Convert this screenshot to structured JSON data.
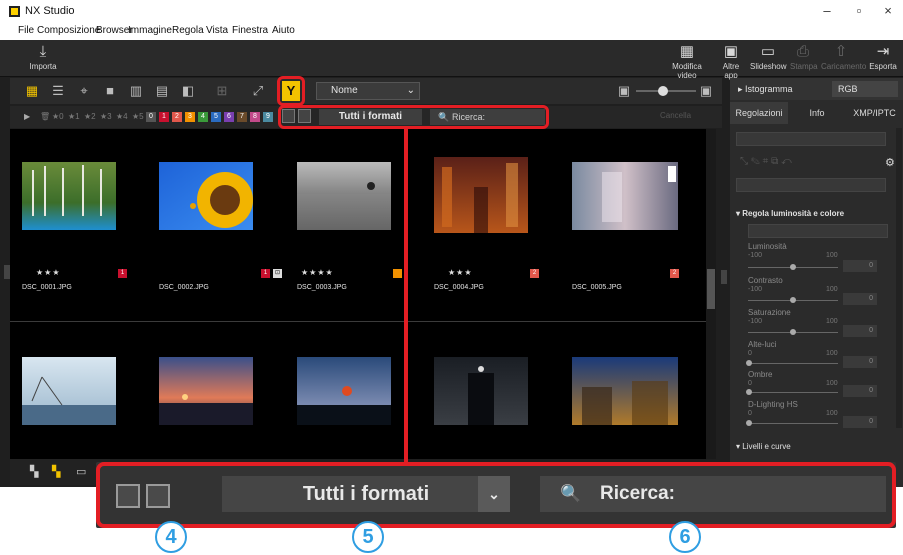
{
  "window": {
    "title": "NX Studio",
    "controls": [
      "–",
      "▫",
      "×"
    ]
  },
  "menu": [
    "File",
    "Composizione",
    "Browser",
    "Immagine",
    "Regola",
    "Vista",
    "Finestra",
    "Aiuto"
  ],
  "toolbar": {
    "import_label": "Importa",
    "right_buttons": [
      {
        "label": "Modifica video",
        "icon": "video-edit-icon",
        "disabled": false
      },
      {
        "label": "Altre app",
        "icon": "app-icon",
        "disabled": false
      },
      {
        "label": "Slideshow",
        "icon": "slideshow-icon",
        "disabled": false
      },
      {
        "label": "Stampa",
        "icon": "print-icon",
        "disabled": true
      },
      {
        "label": "Caricamento",
        "icon": "upload-icon",
        "disabled": true
      },
      {
        "label": "Esporta",
        "icon": "export-icon",
        "disabled": false
      }
    ]
  },
  "viewbar": {
    "sort_label": "Nome"
  },
  "filterbar": {
    "ratings": [
      "★0",
      "★1",
      "★2",
      "★3",
      "★4",
      "★5"
    ],
    "labels": [
      "0",
      "1",
      "2",
      "3",
      "4",
      "5",
      "6",
      "7",
      "8",
      "9"
    ],
    "format_value": "Tutti i formati",
    "search_placeholder": "Ricerca:",
    "clear_label": "Cancella"
  },
  "thumbnails": [
    {
      "name": "DSC_0001.JPG",
      "stars": "★★★",
      "badge": "1",
      "badge_color": "#c8102e",
      "scene": "forest"
    },
    {
      "name": "DSC_0002.JPG",
      "stars": "",
      "badge": "1",
      "badge_color": "#c8102e",
      "scene": "sunflower"
    },
    {
      "name": "DSC_0003.JPG",
      "stars": "★★★★",
      "badge": "",
      "badge_color": "#f29100",
      "scene": "bw"
    },
    {
      "name": "DSC_0004.JPG",
      "stars": "★★★",
      "badge": "2",
      "badge_color": "#e2584c",
      "scene": "alley"
    },
    {
      "name": "DSC_0005.JPG",
      "stars": "",
      "badge": "2",
      "badge_color": "#e2584c",
      "scene": "blur"
    },
    {
      "name": "",
      "stars": "",
      "badge": "",
      "badge_color": "",
      "scene": "sea"
    },
    {
      "name": "",
      "stars": "",
      "badge": "",
      "badge_color": "",
      "scene": "sunset"
    },
    {
      "name": "",
      "stars": "",
      "badge": "",
      "badge_color": "",
      "scene": "sun"
    },
    {
      "name": "",
      "stars": "",
      "badge": "",
      "badge_color": "",
      "scene": "dark"
    },
    {
      "name": "",
      "stars": "",
      "badge": "",
      "badge_color": "",
      "scene": "night"
    }
  ],
  "right_panel": {
    "histogram_label": "Istogramma",
    "histogram_mode": "RGB",
    "tabs": [
      "Regolazioni",
      "Info",
      "XMP/IPTC"
    ],
    "section_title": "Regola luminosità e colore",
    "sliders": [
      {
        "label": "Luminosità",
        "min": "-100",
        "max": "100",
        "value": "0",
        "pos": 0.5
      },
      {
        "label": "Contrasto",
        "min": "-100",
        "max": "100",
        "value": "0",
        "pos": 0.5
      },
      {
        "label": "Saturazione",
        "min": "-100",
        "max": "100",
        "value": "0",
        "pos": 0.5
      },
      {
        "label": "Alte-luci",
        "min": "0",
        "max": "100",
        "value": "0",
        "pos": 0.0
      },
      {
        "label": "Ombre",
        "min": "0",
        "max": "100",
        "value": "0",
        "pos": 0.0
      },
      {
        "label": "D-Lighting HS",
        "min": "0",
        "max": "100",
        "value": "0",
        "pos": 0.0
      }
    ],
    "levels_label": "Livelli e curve"
  },
  "zoom": {
    "format_value": "Tutti i formati",
    "search_placeholder": "Ricerca:"
  },
  "callouts": [
    "4",
    "5",
    "6"
  ],
  "colors": {
    "accent_red": "#e31e24",
    "callout_blue": "#2f9ee2",
    "filter_yellow": "#f2c300"
  }
}
